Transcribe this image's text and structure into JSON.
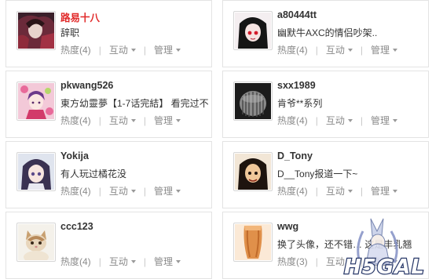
{
  "action_labels": {
    "heat_prefix": "热度",
    "interact": "互动",
    "manage": "管理"
  },
  "cards": [
    {
      "username": "路易十八",
      "username_color": "#e12a2a",
      "status": "辞职",
      "heat": "(4)",
      "avatar_icon": "anime-avatar-red-dark"
    },
    {
      "username": "a80444tt",
      "status": "幽默牛AXC的情侣吵架..",
      "heat": "(4)",
      "avatar_icon": "anime-avatar-black-hair-red-eyes"
    },
    {
      "username": "pkwang526",
      "status": "東方幼靈夢【1-7话完結】 看完过不",
      "heat": "(4)",
      "avatar_icon": "anime-avatar-pink"
    },
    {
      "username": "sxx1989",
      "status": "肯爷**系列",
      "heat": "(4)",
      "avatar_icon": "dark-helmet-avatar"
    },
    {
      "username": "Yokija",
      "status": "有人玩过橘花没",
      "heat": "(4)",
      "avatar_icon": "anime-avatar-purple-hair"
    },
    {
      "username": "D_Tony",
      "status": "D__Tony报道一下~",
      "heat": "(4)",
      "avatar_icon": "anime-avatar-dark-face"
    },
    {
      "username": "ccc123",
      "status": "",
      "heat": "(4)",
      "avatar_icon": "kitten-avatar"
    },
    {
      "username": "wwg",
      "status": "换了头像，还不错… 这是丰乳翘",
      "heat": "(3)",
      "avatar_icon": "orange-figure-avatar"
    }
  ],
  "watermark": {
    "text": "H5GAL",
    "icon": "anime-girl-watermark"
  }
}
